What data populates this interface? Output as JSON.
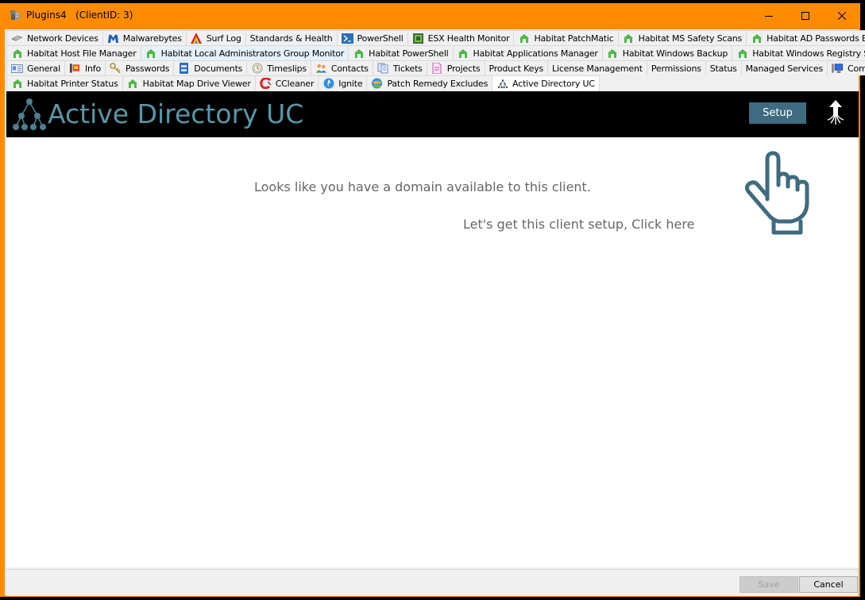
{
  "window": {
    "title": "Plugins4   (ClientID: 3)",
    "border_color": "#ff8c00",
    "controls": [
      "minimize",
      "maximize",
      "close"
    ]
  },
  "tab_rows": [
    [
      {
        "label": "Network Devices",
        "icon": "network-device-icon"
      },
      {
        "label": "Malwarebytes",
        "icon": "malwarebytes-icon"
      },
      {
        "label": "Surf Log",
        "icon": "surflog-icon"
      },
      {
        "label": "Standards & Health",
        "icon": ""
      },
      {
        "label": "PowerShell",
        "icon": "powershell-icon"
      },
      {
        "label": "ESX Health Monitor",
        "icon": "esx-icon"
      },
      {
        "label": "Habitat PatchMatic",
        "icon": "habitat-icon"
      },
      {
        "label": "Habitat MS Safety Scans",
        "icon": "habitat-icon"
      },
      {
        "label": "Habitat AD Passwords Expired",
        "icon": "habitat-icon"
      }
    ],
    [
      {
        "label": "Habitat Host File Manager",
        "icon": "habitat-icon"
      },
      {
        "label": "Habitat Local Administrators Group Monitor",
        "icon": "habitat-icon",
        "highlighted": true
      },
      {
        "label": "Habitat PowerShell",
        "icon": "habitat-icon"
      },
      {
        "label": "Habitat Applications Manager",
        "icon": "habitat-icon"
      },
      {
        "label": "Habitat Windows Backup",
        "icon": "habitat-icon"
      },
      {
        "label": "Habitat Windows Registry Search",
        "icon": "habitat-icon"
      }
    ],
    [
      {
        "label": "General",
        "icon": "general-icon"
      },
      {
        "label": "Info",
        "icon": "info-icon"
      },
      {
        "label": "Passwords",
        "icon": "passwords-icon"
      },
      {
        "label": "Documents",
        "icon": "documents-icon"
      },
      {
        "label": "Timeslips",
        "icon": "timeslips-icon"
      },
      {
        "label": "Contacts",
        "icon": "contacts-icon"
      },
      {
        "label": "Tickets",
        "icon": "tickets-icon"
      },
      {
        "label": "Projects",
        "icon": "projects-icon"
      },
      {
        "label": "Product Keys",
        "icon": ""
      },
      {
        "label": "License Management",
        "icon": ""
      },
      {
        "label": "Permissions",
        "icon": ""
      },
      {
        "label": "Status",
        "icon": ""
      },
      {
        "label": "Managed Services",
        "icon": ""
      },
      {
        "label": "Computers",
        "icon": "computers-icon"
      }
    ],
    [
      {
        "label": "Habitat Printer Status",
        "icon": "habitat-icon"
      },
      {
        "label": "Habitat Map Drive Viewer",
        "icon": "habitat-icon"
      },
      {
        "label": "CCleaner",
        "icon": "ccleaner-icon"
      },
      {
        "label": "Ignite",
        "icon": "ignite-icon"
      },
      {
        "label": "Patch Remedy Excludes",
        "icon": "patch-remedy-icon"
      },
      {
        "label": "Active Directory UC",
        "icon": "active-directory-icon",
        "active": true
      }
    ]
  ],
  "banner": {
    "title": "Active Directory UC",
    "setup_label": "Setup",
    "accent": "#5a96a8",
    "button_color": "#3e6b80"
  },
  "content": {
    "message": "Looks like you have a domain available to this client.",
    "call_to_action": "Let's get this client setup, Click here"
  },
  "footer": {
    "save_label": "Save",
    "cancel_label": "Cancel",
    "save_enabled": false
  }
}
